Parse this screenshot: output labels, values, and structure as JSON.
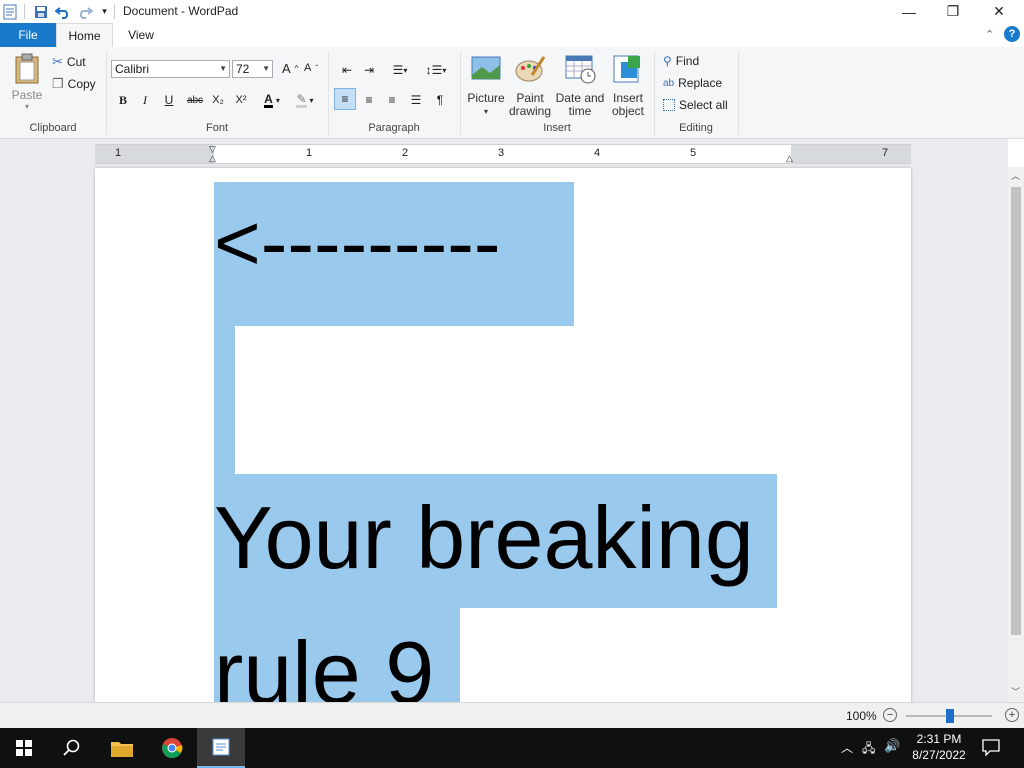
{
  "window": {
    "title": "Document - WordPad",
    "minimize_glyph": "—",
    "restore_glyph": "❐",
    "close_glyph": "✕"
  },
  "tabs": {
    "file": "File",
    "home": "Home",
    "view": "View"
  },
  "clipboard": {
    "paste": "Paste",
    "cut": "Cut",
    "copy": "Copy",
    "label": "Clipboard"
  },
  "font": {
    "family": "Calibri",
    "size": "72",
    "label": "Font",
    "bold": "B",
    "italic": "I",
    "underline": "U",
    "strike": "abc",
    "subscript": "X₂",
    "superscript": "X²"
  },
  "paragraph": {
    "label": "Paragraph"
  },
  "insert": {
    "picture": "Picture",
    "paint_line1": "Paint",
    "paint_line2": "drawing",
    "datetime_line1": "Date and",
    "datetime_line2": "time",
    "object_line1": "Insert",
    "object_line2": "object",
    "label": "Insert"
  },
  "editing": {
    "find": "Find",
    "replace": "Replace",
    "select_all": "Select all",
    "label": "Editing"
  },
  "ruler": {
    "numbers": [
      "1",
      "1",
      "2",
      "3",
      "4",
      "5",
      "7"
    ]
  },
  "document": {
    "line1": "<---------",
    "line2": "Your breaking",
    "line3": "rule 9"
  },
  "status": {
    "zoom": "100%"
  },
  "taskbar": {
    "time": "2:31 PM",
    "date": "8/27/2022"
  },
  "colors": {
    "accent": "#1979ca",
    "selection": "#99c9ec",
    "taskbar": "#101010"
  }
}
